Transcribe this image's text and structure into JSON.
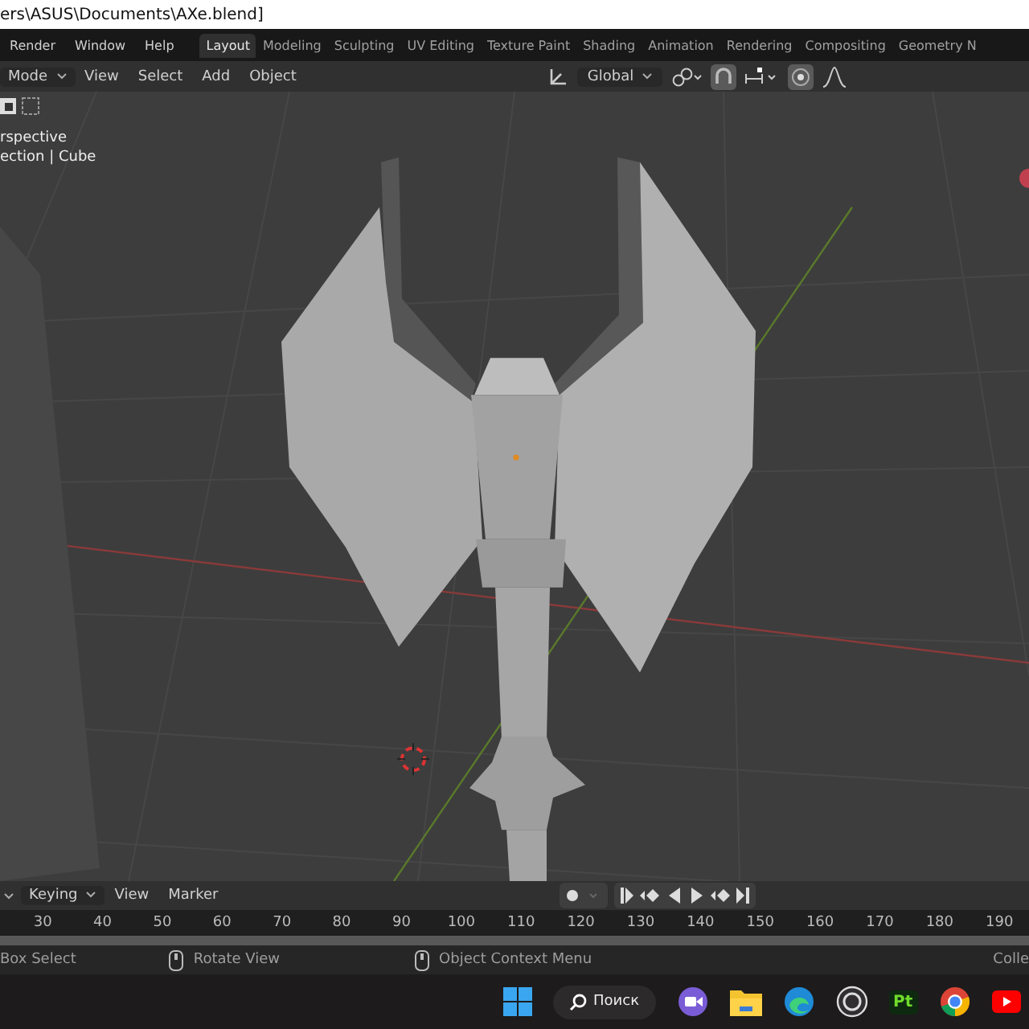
{
  "window": {
    "title": "ers\\ASUS\\Documents\\AXe.blend]"
  },
  "menu": [
    "Render",
    "Window",
    "Help"
  ],
  "workspace_tabs": [
    {
      "label": "Layout",
      "selected": true
    },
    {
      "label": "Modeling",
      "selected": false
    },
    {
      "label": "Sculpting",
      "selected": false
    },
    {
      "label": "UV Editing",
      "selected": false
    },
    {
      "label": "Texture Paint",
      "selected": false
    },
    {
      "label": "Shading",
      "selected": false
    },
    {
      "label": "Animation",
      "selected": false
    },
    {
      "label": "Rendering",
      "selected": false
    },
    {
      "label": "Compositing",
      "selected": false
    },
    {
      "label": "Geometry N",
      "selected": false
    }
  ],
  "viewport_header": {
    "mode": "Mode",
    "menus": [
      "View",
      "Select",
      "Add",
      "Object"
    ],
    "orientation": "Global",
    "snap_on": true,
    "proportional_on": true
  },
  "viewport": {
    "overlay_lines": [
      "rspective",
      "ection | Cube"
    ]
  },
  "timeline": {
    "keying": "Keying",
    "menus": [
      "View",
      "Marker"
    ],
    "ruler": [
      "30",
      "40",
      "50",
      "60",
      "70",
      "80",
      "90",
      "100",
      "110",
      "120",
      "130",
      "140",
      "150",
      "160",
      "170",
      "180",
      "190"
    ]
  },
  "status_bar": [
    {
      "kind": "text",
      "label": "Box Select"
    },
    {
      "kind": "mouse",
      "label": "Rotate View"
    },
    {
      "kind": "mouse",
      "label": "Object Context Menu"
    }
  ],
  "status_right": "Colle",
  "taskbar": {
    "search_label": "Поиск",
    "pt_label": "Pt"
  }
}
